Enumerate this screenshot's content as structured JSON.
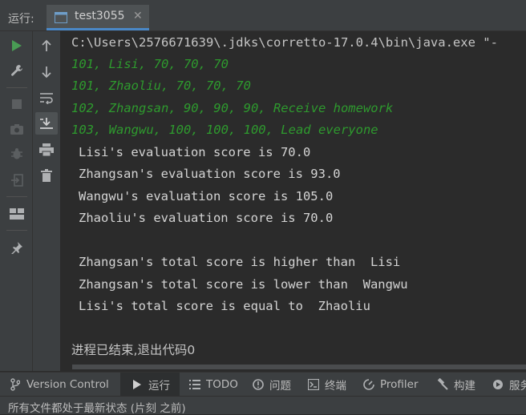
{
  "run_window": {
    "label": "运行:",
    "tab": {
      "name": "test3055",
      "close": "✕"
    }
  },
  "console": {
    "command": "C:\\Users\\2576671639\\.jdks\\corretto-17.0.4\\bin\\java.exe \"-",
    "input_lines": [
      "101, Lisi, 70, 70, 70",
      "101, Zhaoliu, 70, 70, 70",
      "102, Zhangsan, 90, 90, 90, Receive homework",
      "103, Wangwu, 100, 100, 100, Lead everyone"
    ],
    "output_lines": [
      "Lisi's evaluation score is 70.0",
      "Zhangsan's evaluation score is 93.0",
      "Wangwu's evaluation score is 105.0",
      "Zhaoliu's evaluation score is 70.0",
      "",
      "Zhangsan's total score is higher than  Lisi",
      "Zhangsan's total score is lower than  Wangwu",
      "Lisi's total score is equal to  Zhaoliu"
    ],
    "exit_message": "进程已结束,退出代码0"
  },
  "bottom_tabs": [
    {
      "label": "Version Control",
      "icon": "branch-icon"
    },
    {
      "label": "运行",
      "icon": "play-icon"
    },
    {
      "label": "TODO",
      "icon": "list-icon"
    },
    {
      "label": "问题",
      "icon": "info-icon"
    },
    {
      "label": "终端",
      "icon": "terminal-icon"
    },
    {
      "label": "Profiler",
      "icon": "profiler-icon"
    },
    {
      "label": "构建",
      "icon": "hammer-icon"
    },
    {
      "label": "服务",
      "icon": "services-icon"
    }
  ],
  "status_bar": {
    "text": "所有文件都处于最新状态 (片刻 之前)"
  },
  "colors": {
    "background": "#2b2b2b",
    "panel": "#3c3f41",
    "input_green": "#2e9a2e",
    "tab_underline": "#4a88c7",
    "run_green": "#499c54"
  }
}
